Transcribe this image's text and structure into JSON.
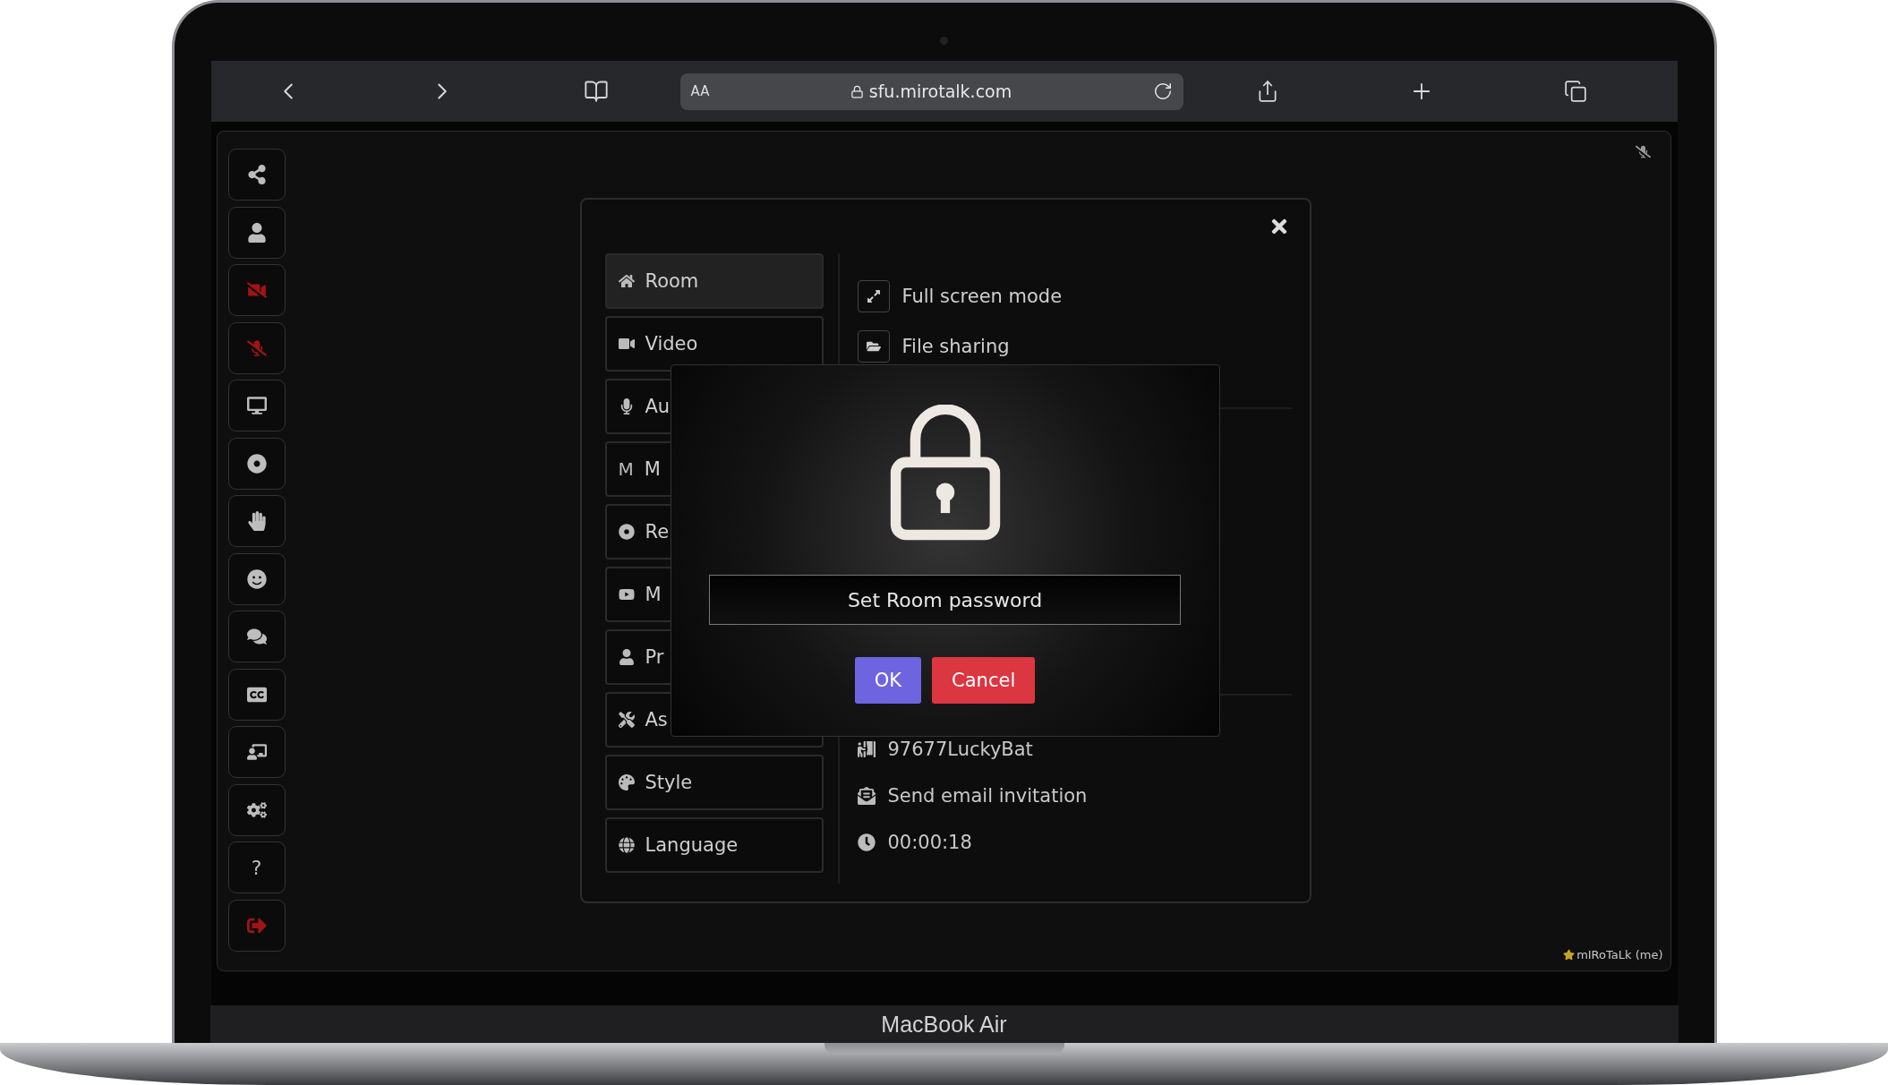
{
  "browser": {
    "text_size": "AA",
    "url": "sfu.mirotalk.com"
  },
  "sidebar": [
    {
      "kind": "share",
      "color": "#bdbdbd"
    },
    {
      "kind": "user",
      "color": "#bdbdbd"
    },
    {
      "kind": "video-off",
      "color": "#a11414"
    },
    {
      "kind": "mic-off",
      "color": "#a11414"
    },
    {
      "kind": "screen",
      "color": "#bdbdbd"
    },
    {
      "kind": "record",
      "color": "#bdbdbd"
    },
    {
      "kind": "hand",
      "color": "#bdbdbd"
    },
    {
      "kind": "smile",
      "color": "#bdbdbd"
    },
    {
      "kind": "chat",
      "color": "#bdbdbd"
    },
    {
      "kind": "captions",
      "color": "#bdbdbd"
    },
    {
      "kind": "whiteboard",
      "color": "#bdbdbd"
    },
    {
      "kind": "settings",
      "color": "#bdbdbd"
    },
    {
      "kind": "help",
      "text": "?",
      "color": "#bdbdbd"
    },
    {
      "kind": "exit",
      "color": "#a11414"
    }
  ],
  "settings": {
    "nav": [
      {
        "kind": "home",
        "label": "Room",
        "selected": true
      },
      {
        "kind": "video",
        "label": "Video",
        "selected": false
      },
      {
        "kind": "mic",
        "label": "Au",
        "selected": false
      },
      {
        "kind": "letter",
        "glyph": "M",
        "label": "M",
        "selected": false
      },
      {
        "kind": "record",
        "label": "Re",
        "selected": false
      },
      {
        "kind": "youtube",
        "label": "M",
        "selected": false
      },
      {
        "kind": "user",
        "label": "Pr",
        "selected": false
      },
      {
        "kind": "tools",
        "label": "As",
        "selected": false
      },
      {
        "kind": "palette",
        "label": "Style",
        "selected": false
      },
      {
        "kind": "globe",
        "label": "Language",
        "selected": false
      }
    ],
    "top_items": [
      {
        "kind": "expand",
        "label": "Full screen mode"
      },
      {
        "kind": "folder",
        "label": "File sharing"
      }
    ],
    "bottom_items": [
      {
        "kind": "room",
        "label": "97677LuckyBat"
      },
      {
        "kind": "mail",
        "label": "Send email invitation"
      },
      {
        "kind": "clock",
        "label": "00:00:18"
      }
    ]
  },
  "password_dialog": {
    "placeholder": "Set Room password",
    "buttons": [
      {
        "kind": "confirm",
        "label": "OK"
      },
      {
        "kind": "cancel",
        "label": "Cancel"
      }
    ]
  },
  "participant": {
    "name": "mIRoTaLk (me)"
  },
  "device_label": "MacBook Air"
}
